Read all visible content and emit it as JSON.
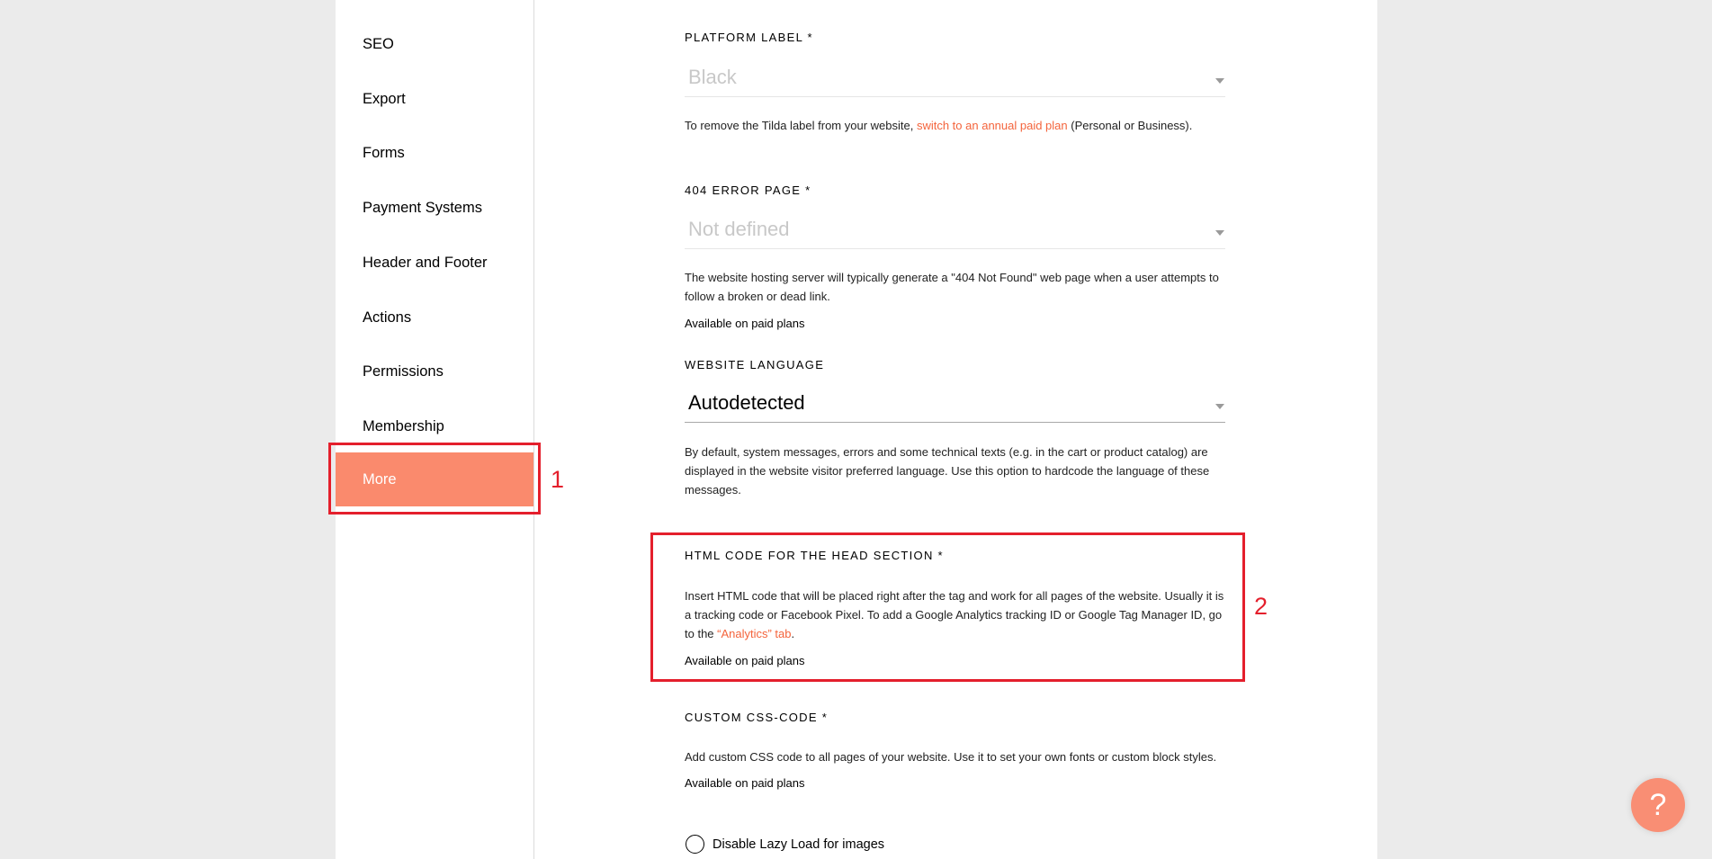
{
  "sidebar": {
    "items": [
      {
        "label": "SEO",
        "active": false
      },
      {
        "label": "Export",
        "active": false
      },
      {
        "label": "Forms",
        "active": false
      },
      {
        "label": "Payment Systems",
        "active": false
      },
      {
        "label": "Header and Footer",
        "active": false
      },
      {
        "label": "Actions",
        "active": false
      },
      {
        "label": "Permissions",
        "active": false
      },
      {
        "label": "Membership",
        "active": false
      },
      {
        "label": "More",
        "active": true
      }
    ]
  },
  "annotations": {
    "one": "1",
    "two": "2"
  },
  "colors": {
    "accent": "#fa8a6d",
    "link": "#f4643c",
    "annotation": "#e41f2c"
  },
  "fields": {
    "platform_label": {
      "label": "PLATFORM LABEL *",
      "value": "Black",
      "desc_before": "To remove the Tilda label from your website, ",
      "desc_link": "switch to an annual paid plan",
      "desc_after": " (Personal or Business)."
    },
    "error_page": {
      "label": "404 ERROR PAGE *",
      "value": "Not defined",
      "desc": "The website hosting server will typically generate a \"404 Not Found\" web page when a user attempts to follow a broken or dead link.",
      "availability": "Available on paid plans"
    },
    "website_language": {
      "label": "WEBSITE LANGUAGE",
      "value": "Autodetected",
      "desc": "By default, system messages, errors and some technical texts (e.g. in the cart or product catalog) are displayed in the website visitor preferred language. Use this option to hardcode the language of these messages."
    },
    "head_html": {
      "label": "HTML CODE FOR THE HEAD SECTION *",
      "desc_before": "Insert HTML code that will be placed right after the tag and work for all pages of the website. Usually it is a tracking code or Facebook Pixel. To add a Google Analytics tracking ID or Google Tag Manager ID, go to the ",
      "desc_link": "“Analytics” tab",
      "desc_after": ".",
      "availability": "Available on paid plans"
    },
    "custom_css": {
      "label": "CUSTOM CSS-CODE *",
      "desc": "Add custom CSS code to all pages of your website. Use it to set your own fonts or custom block styles.",
      "availability": "Available on paid plans"
    },
    "lazy_load": {
      "label": "Disable Lazy Load for images",
      "checked": false
    }
  },
  "help": {
    "icon": "question-mark-icon",
    "label": "?"
  }
}
